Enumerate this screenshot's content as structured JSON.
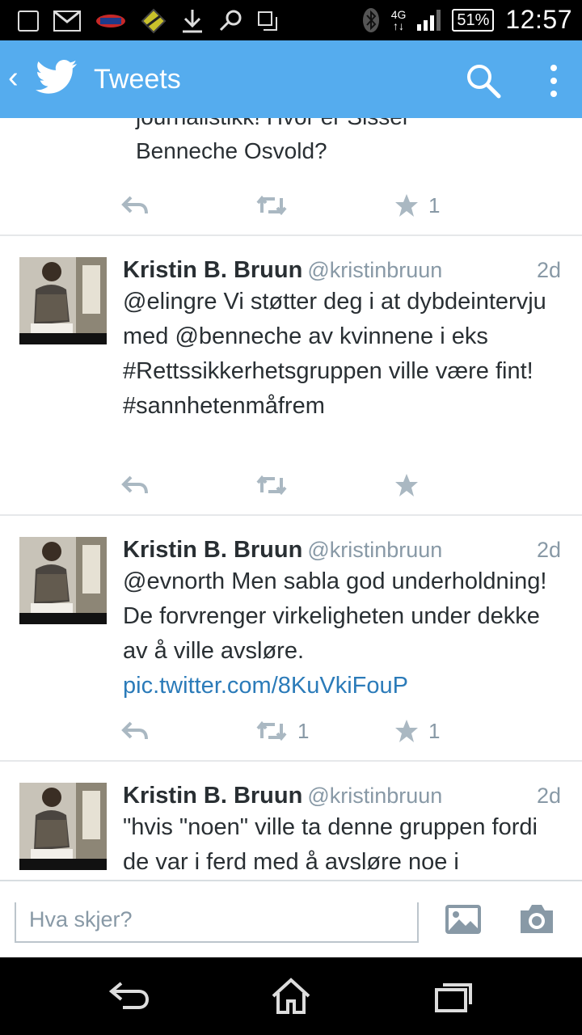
{
  "status_bar": {
    "network": "4G",
    "battery": "51%",
    "time": "12:57"
  },
  "app_bar": {
    "title": "Tweets",
    "icons": [
      "back-chevron-icon",
      "twitter-bird-icon",
      "search-icon",
      "overflow-menu-icon"
    ]
  },
  "partial_tweet": {
    "text_cut": "journalistikk! Hvor er Sissel",
    "text": "Benneche Osvold?",
    "favorites": "1"
  },
  "tweets": [
    {
      "name": "Kristin B. Bruun",
      "handle": "@kristinbruun",
      "time": "2d",
      "text": "@elingre Vi støtter deg i at dybdeintervju med @benneche av kvinnene i eks #Rettssikkerhetsgruppen ville være fint! #sannhetenmåfrem",
      "retweets": "",
      "favorites": ""
    },
    {
      "name": "Kristin B. Bruun",
      "handle": "@kristinbruun",
      "time": "2d",
      "text": "@evnorth Men sabla god underholdning! De forvrenger virkeligheten under dekke av å ville avsløre. ",
      "link": "pic.twitter.com/8KuVkiFouP",
      "retweets": "1",
      "favorites": "1"
    },
    {
      "name": "Kristin B. Bruun",
      "handle": "@kristinbruun",
      "time": "2d",
      "text": "\"hvis \"noen\" ville ta denne gruppen fordi de var i ferd med å avsløre noe i"
    }
  ],
  "composer": {
    "placeholder": "Hva skjer?",
    "icons": [
      "photo-icon",
      "camera-icon"
    ]
  },
  "nav_bar": {
    "icons": [
      "back-icon",
      "home-icon",
      "recent-apps-icon"
    ]
  },
  "colors": {
    "brand": "#55acee",
    "text": "#292f33",
    "secondary": "#8899a6",
    "link": "#2b7bb9"
  }
}
